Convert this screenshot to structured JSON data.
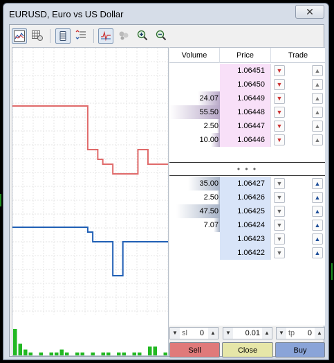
{
  "window": {
    "title": "EURUSD, Euro vs US Dollar",
    "close_glyph": "✕"
  },
  "toolbar": {
    "icons": [
      "chart-icon",
      "table-grid-icon",
      "depth-of-market-icon",
      "order-list-icon",
      "tick-chart-icon",
      "bubbles-icon",
      "zoom-in-icon",
      "zoom-out-icon"
    ]
  },
  "colors": {
    "ask_line": "#e06a6a",
    "bid_line": "#1f5fb5",
    "ask_price_bg": "#f8e0f8",
    "bid_price_bg": "#d8e4f8",
    "volume_bar": "#b8a8c8",
    "bid_volume_bar": "#a8b4c8",
    "sell": "#e07a7a",
    "close": "#e6e6a8",
    "buy": "#8aa4d8",
    "volume_histogram": "#22b822"
  },
  "dom": {
    "headers": {
      "volume": "Volume",
      "price": "Price",
      "trade": "Trade"
    },
    "asks": [
      {
        "volume": "",
        "price": "1.06451",
        "vol_fill": 0
      },
      {
        "volume": "",
        "price": "1.06450",
        "vol_fill": 0
      },
      {
        "volume": "24.07",
        "price": "1.06449",
        "vol_fill": 0.44
      },
      {
        "volume": "55.50",
        "price": "1.06448",
        "vol_fill": 1.0
      },
      {
        "volume": "2.50",
        "price": "1.06447",
        "vol_fill": 0.05
      },
      {
        "volume": "10.00",
        "price": "1.06446",
        "vol_fill": 0.18
      }
    ],
    "spread_marker": "• • •",
    "bids": [
      {
        "volume": "35.00",
        "price": "1.06427",
        "vol_fill": 0.63
      },
      {
        "volume": "2.50",
        "price": "1.06426",
        "vol_fill": 0.05
      },
      {
        "volume": "47.50",
        "price": "1.06425",
        "vol_fill": 0.86
      },
      {
        "volume": "7.07",
        "price": "1.06424",
        "vol_fill": 0.13
      },
      {
        "volume": "",
        "price": "1.06423",
        "vol_fill": 0
      },
      {
        "volume": "",
        "price": "1.06422",
        "vol_fill": 0
      }
    ]
  },
  "trade": {
    "sl_label": "sl",
    "sl_value": "0",
    "lot_value": "0.01",
    "tp_label": "tp",
    "tp_value": "0",
    "sell_label": "Sell",
    "close_label": "Close",
    "buy_label": "Buy"
  },
  "chart_data": {
    "type": "line",
    "series": [
      {
        "values": [
          1.06458,
          1.06458,
          1.06458,
          1.06458,
          1.06458,
          1.06458,
          1.06458,
          1.06458,
          1.06458,
          1.06458,
          1.06458,
          1.06458,
          1.06458,
          1.06458,
          1.06458,
          1.06449,
          1.06449,
          1.06447,
          1.06446,
          1.06446,
          1.06444,
          1.06444,
          1.06444,
          1.06444,
          1.06444,
          1.06449,
          1.06449,
          1.06446,
          1.06446,
          1.06446,
          1.06446,
          1.06446
        ]
      },
      {
        "values": [
          1.06433,
          1.06433,
          1.06433,
          1.06433,
          1.06433,
          1.06433,
          1.06433,
          1.06433,
          1.06433,
          1.06433,
          1.06433,
          1.06433,
          1.06433,
          1.06433,
          1.06433,
          1.06432,
          1.0643,
          1.0643,
          1.0643,
          1.0643,
          1.06423,
          1.06423,
          1.0643,
          1.0643,
          1.0643,
          1.0643,
          1.0643,
          1.0643,
          1.0643,
          1.0643,
          1.0643,
          1.0643
        ]
      }
    ],
    "histogram": [
      9,
      4,
      2,
      1,
      0,
      1,
      0,
      1,
      1,
      2,
      1,
      0,
      1,
      1,
      0,
      1,
      0,
      1,
      1,
      0,
      1,
      1,
      0,
      1,
      1,
      0,
      3,
      3,
      0,
      1
    ]
  }
}
